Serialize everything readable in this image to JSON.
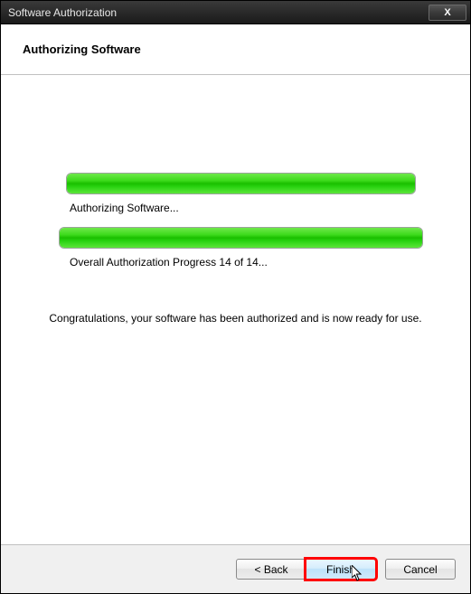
{
  "window": {
    "title": "Software Authorization",
    "close_label": "X"
  },
  "header": {
    "title": "Authorizing Software"
  },
  "progress": {
    "step": {
      "percent": 100,
      "label": "Authorizing Software..."
    },
    "overall": {
      "percent": 100,
      "current": 14,
      "total": 14,
      "label": "Overall Authorization Progress 14 of 14..."
    }
  },
  "message": {
    "congrats": "Congratulations, your software has been authorized and is now ready for use."
  },
  "buttons": {
    "back": "< Back",
    "finish": "Finish",
    "cancel": "Cancel"
  }
}
